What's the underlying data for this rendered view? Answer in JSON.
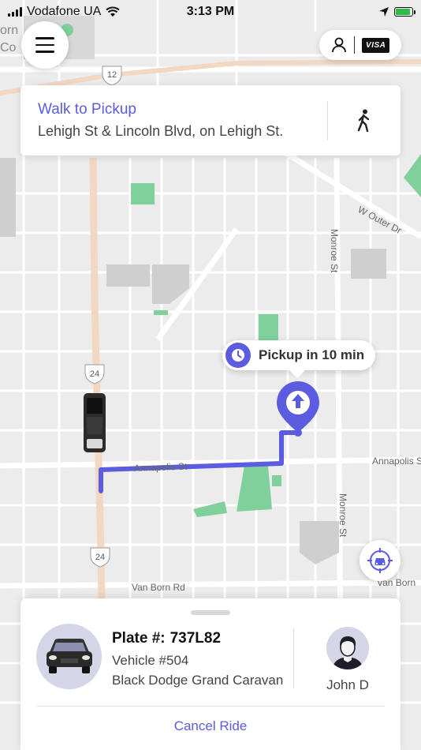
{
  "status_bar": {
    "carrier": "Vodafone UA",
    "time": "3:13 PM"
  },
  "map": {
    "road_labels": {
      "route_12": "12",
      "route_24_upper": "24",
      "route_24_lower": "24",
      "w_outer_dr": "W Outer Dr",
      "monroe_st_upper": "Monroe St",
      "monroe_st_lower": "Monroe St",
      "annapolis_st_left": "Annapolis St",
      "annapolis_st_right": "Annapolis S",
      "van_born_rd_left": "Van Born Rd",
      "van_born_rd_right": "Van Born",
      "poi_fragment_1": "orn",
      "poi_fragment_2": "Co"
    },
    "colors": {
      "route": "#5b5ce0",
      "accent": "#5b5ce0",
      "park": "#7fd09a",
      "road": "#ffffff",
      "highway": "#f2d7c3",
      "background": "#ececec",
      "building": "#cfcfcf"
    }
  },
  "walk_card": {
    "title": "Walk to Pickup",
    "subtitle": "Lehigh St & Lincoln Blvd, on Lehigh St.",
    "icon": "walking-person-icon"
  },
  "header": {
    "menu_icon": "hamburger-menu-icon",
    "profile_icon": "person-icon",
    "payment_card": "VISA"
  },
  "pickup": {
    "text": "Pickup in 10 min",
    "icon": "clock-icon"
  },
  "locate_icon": "locate-vehicle-icon",
  "ride": {
    "plate_label": "Plate #:",
    "plate": "737L82",
    "vehicle_number": "Vehicle #504",
    "vehicle_model": "Black Dodge Grand Caravan",
    "driver_name": "John D",
    "cancel_label": "Cancel Ride"
  }
}
